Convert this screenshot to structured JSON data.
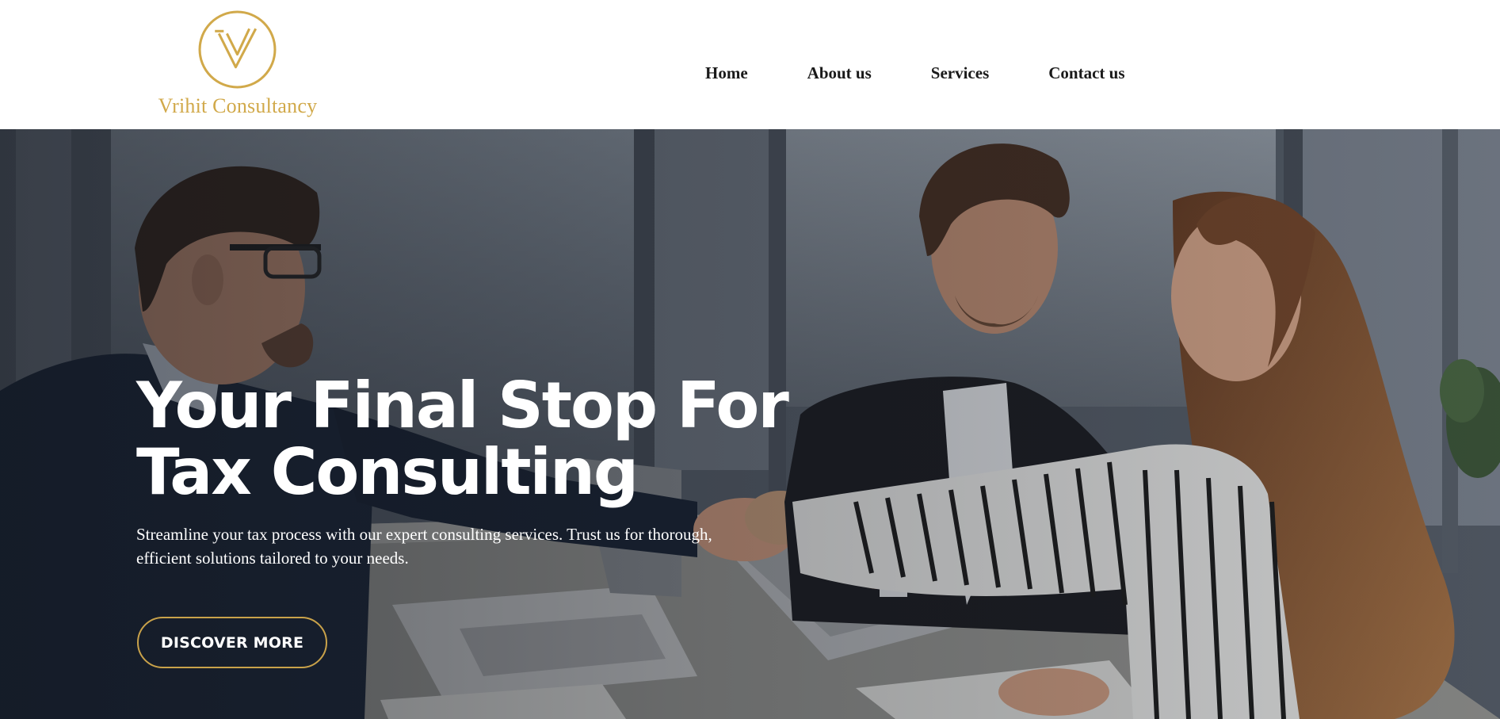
{
  "brand": {
    "name": "Vrihit Consultancy",
    "logo_icon": "v-monogram-circle-icon",
    "color": "#d1a94a"
  },
  "nav": {
    "items": [
      {
        "label": "Home"
      },
      {
        "label": "About us"
      },
      {
        "label": "Services"
      },
      {
        "label": "Contact us"
      }
    ]
  },
  "hero": {
    "title_line1": "Your Final Stop For",
    "title_line2": "Tax Consulting",
    "description": "Streamline your tax process with our expert consulting services. Trust us for thorough, efficient solutions tailored to your needs.",
    "cta_label": "DISCOVER MORE",
    "background": "business-handshake-photo",
    "accent_color": "#c9a24a"
  }
}
